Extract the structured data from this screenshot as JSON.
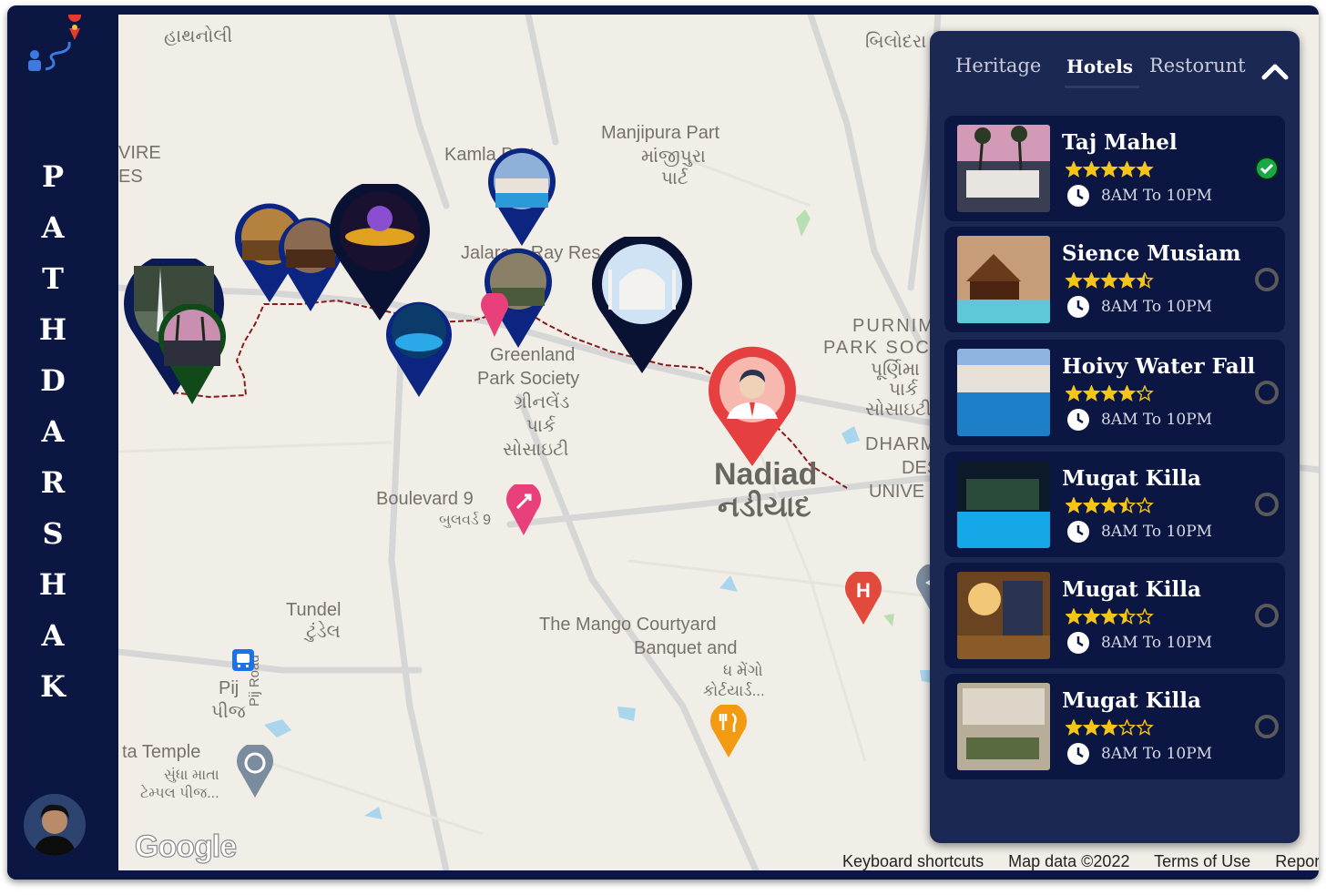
{
  "app": {
    "brand_letters": [
      "P",
      "A",
      "T",
      "H",
      "D",
      "A",
      "R",
      "S",
      "H",
      "A",
      "K"
    ],
    "accent_color": "#0c1642"
  },
  "panel": {
    "tabs": [
      "Heritage",
      "Hotels",
      "Restorunt"
    ],
    "active_tab": "Hotels",
    "hotels": [
      {
        "name": "Taj Mahel",
        "rating": 5,
        "hours": "8AM To 10PM",
        "selected": true
      },
      {
        "name": "Sience Musiam",
        "rating": 4.5,
        "hours": "8AM To 10PM",
        "selected": false
      },
      {
        "name": "Hoivy Water Fall",
        "rating": 4,
        "hours": "8AM To 10PM",
        "selected": false
      },
      {
        "name": "Mugat Killa",
        "rating": 3.5,
        "hours": "8AM To 10PM",
        "selected": false
      },
      {
        "name": "Mugat Killa",
        "rating": 3.5,
        "hours": "8AM To 10PM",
        "selected": false
      },
      {
        "name": "Mugat Killa",
        "rating": 3,
        "hours": "8AM To 10PM",
        "selected": false
      }
    ]
  },
  "map": {
    "labels": {
      "hathnoli": "હાથનોલી",
      "vire": "VIRE",
      "es": "ES",
      "kamlapart": "Kamla Part",
      "manjipura": "Manjipura Part",
      "manjipura_gu": "માંજીપુરા",
      "manjipura_gu2": "પાર્ટ",
      "jalaram": "Jalaram Ray Res",
      "greenland1": "Greenland",
      "greenland2": "Park Society",
      "greenland_gu1": "ગ્રીનલેંડ",
      "greenland_gu2": "પાર્ક",
      "greenland_gu3": "સોસાઇટી",
      "boulevard": "Boulevard 9",
      "boulevard_gu": "બુલવર્ડ 9",
      "purnima1": "PURNIMA",
      "purnima2": "PARK SOC",
      "purnima_gu1": "પૂર્ણિમા",
      "purnima_gu2": "પાર્ક",
      "purnima_gu3": "સોસાઇટી",
      "dharm1": "DHARM",
      "dharm2": "DES",
      "dharm3": "UNIVE",
      "nadiad": "Nadiad",
      "nadiad_gu": "નડીયાદ",
      "tundel": "Tundel",
      "tundel_gu": "ટુંડેલ",
      "mango1": "The Mango Courtyard",
      "mango2": "Banquet and",
      "mango_gu1": "ધ મેંગો",
      "mango_gu2": "કોર્ટયાર્ડ...",
      "pij": "Pij",
      "pij_gu": "પીજ",
      "pijroad": "Pij Road",
      "temple": "ta Temple",
      "temple_gu1": "સુંધા માતા",
      "temple_gu2": "ટેમ્પલ પીજ...",
      "bilodara": "બિલોદરા",
      "google": "Google"
    },
    "attribution": [
      "Keyboard shortcuts",
      "Map data ©2022",
      "Terms of Use",
      "Report a map error"
    ],
    "route_color": "#8b1a1a",
    "pin_color": "#0b2580"
  }
}
